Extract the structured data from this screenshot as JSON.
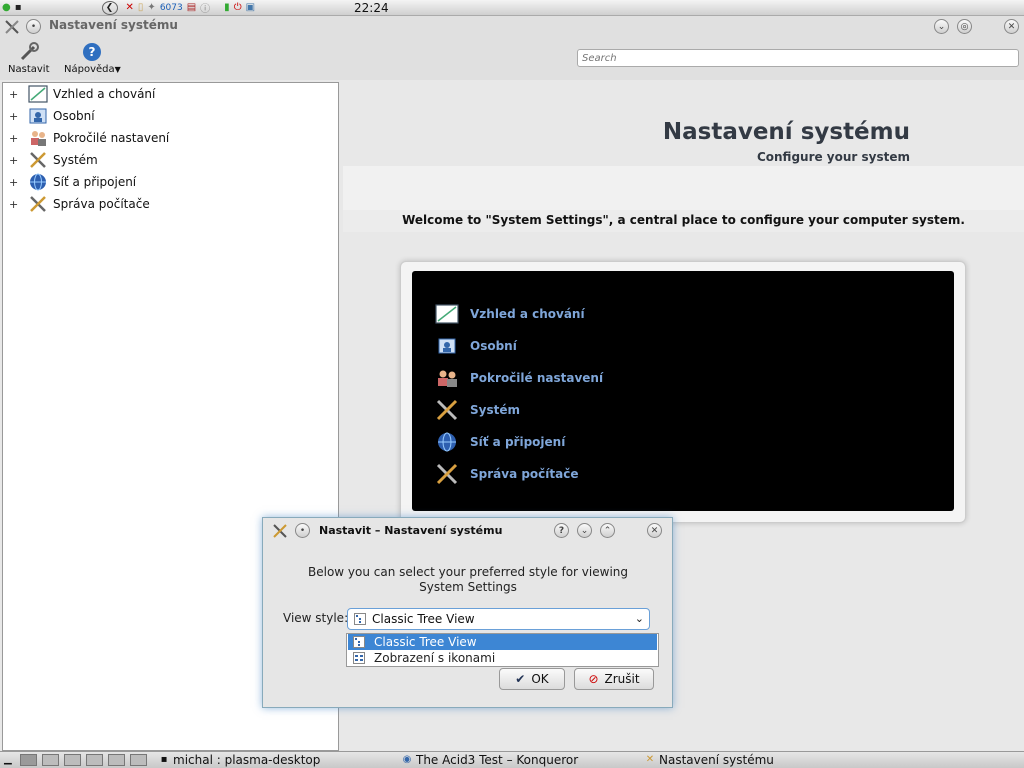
{
  "top_panel": {
    "tray_badge": "6073",
    "clock": "22:24"
  },
  "window": {
    "title": "Nastavení systému"
  },
  "toolbar": {
    "configure_label": "Nastavit",
    "help_label": "Nápověda",
    "search_placeholder": "Search"
  },
  "tree": {
    "items": [
      {
        "label": "Vzhled a chování",
        "icon": "appearance-icon"
      },
      {
        "label": "Osobní",
        "icon": "personal-icon"
      },
      {
        "label": "Pokročilé nastavení",
        "icon": "advanced-users-icon"
      },
      {
        "label": "Systém",
        "icon": "system-tools-icon"
      },
      {
        "label": "Síť a připojení",
        "icon": "network-globe-icon"
      },
      {
        "label": "Správa počítače",
        "icon": "computer-admin-icon"
      }
    ]
  },
  "main": {
    "title": "Nastavení systému",
    "subtitle": "Configure your system",
    "welcome": "Welcome to \"System Settings\", a central place to configure your computer system.",
    "categories": [
      {
        "label": "Vzhled a chování"
      },
      {
        "label": "Osobní"
      },
      {
        "label": "Pokročilé nastavení"
      },
      {
        "label": "Systém"
      },
      {
        "label": "Síť a připojení"
      },
      {
        "label": "Správa počítače"
      }
    ]
  },
  "dialog": {
    "title": "Nastavit – Nastavení systému",
    "text": "Below you can select your preferred style for viewing System Settings",
    "view_style_label": "View style:",
    "selected_value": "Classic Tree View",
    "options": [
      "Classic Tree View",
      "Zobrazení s ikonami"
    ],
    "ok_label": "OK",
    "cancel_label": "Zrušit"
  },
  "taskbar": {
    "tasks": [
      {
        "label": "michal : plasma-desktop"
      },
      {
        "label": "The Acid3 Test – Konqueror"
      },
      {
        "label": "Nastavení systému"
      }
    ]
  },
  "colors": {
    "accent": "#3d86d4",
    "category_text": "#7fa6d9",
    "title_text": "#333a44"
  }
}
